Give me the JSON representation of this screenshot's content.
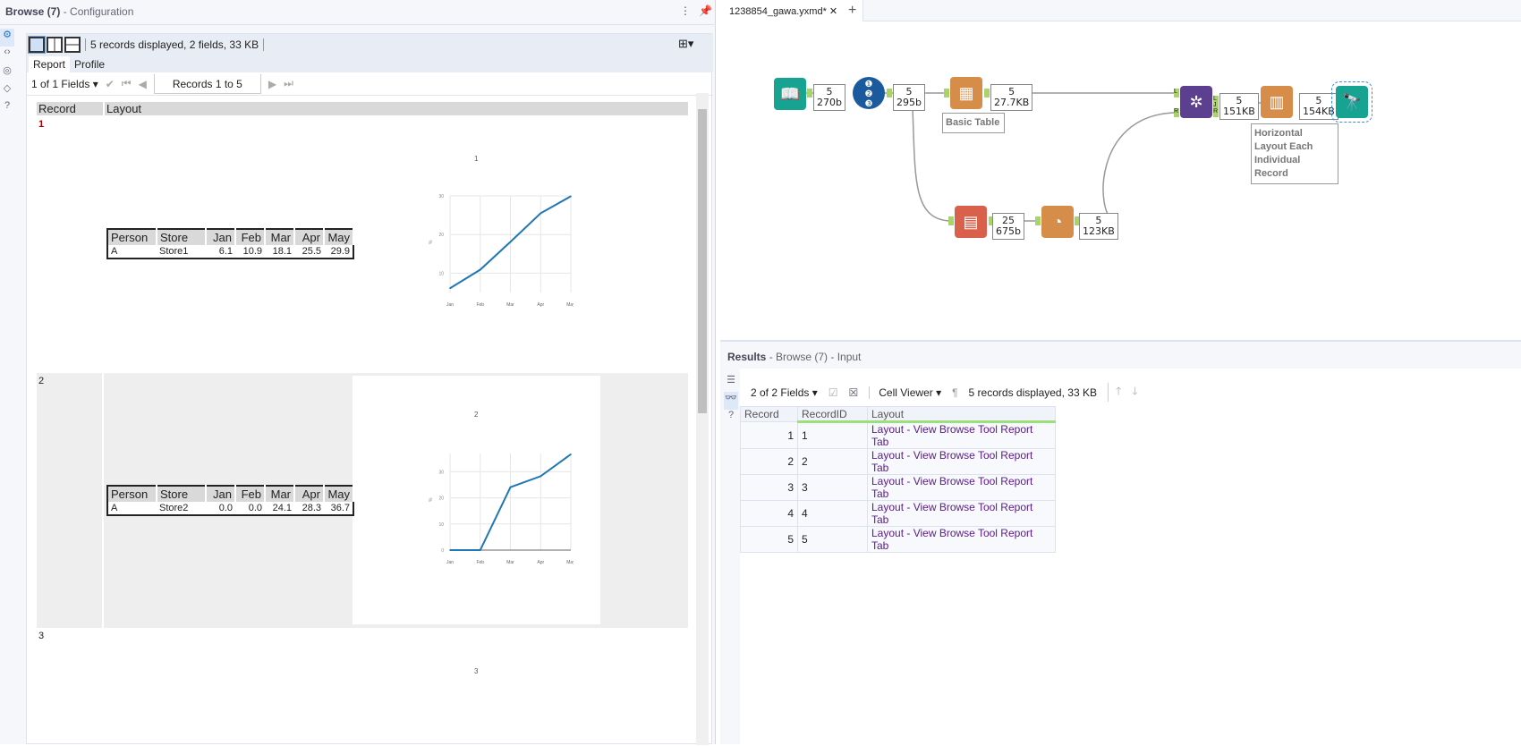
{
  "left_panel": {
    "title": "Browse (7)",
    "subtitle": " - Configuration",
    "status": "5 records displayed, 2 fields, 33 KB",
    "tabs": [
      "Report",
      "Profile"
    ],
    "fields_select": "1 of 1 Fields",
    "records_range": "Records 1 to 5",
    "headers": [
      "Record",
      "Layout"
    ]
  },
  "records": [
    {
      "num": "1",
      "chart_title": "1",
      "table": {
        "headers": [
          "Person",
          "Store",
          "Jan",
          "Feb",
          "Mar",
          "Apr",
          "May"
        ],
        "row": [
          "A",
          "Store1",
          "6.1",
          "10.9",
          "18.1",
          "25.5",
          "29.9"
        ]
      }
    },
    {
      "num": "2",
      "chart_title": "2",
      "table": {
        "headers": [
          "Person",
          "Store",
          "Jan",
          "Feb",
          "Mar",
          "Apr",
          "May"
        ],
        "row": [
          "A",
          "Store2",
          "0.0",
          "0.0",
          "24.1",
          "28.3",
          "36.7"
        ]
      }
    },
    {
      "num": "3",
      "chart_title": "3"
    }
  ],
  "chart_data": [
    {
      "type": "line",
      "title": "1",
      "xlabel": "",
      "ylabel": "%",
      "categories": [
        "Jan",
        "Feb",
        "Mar",
        "Apr",
        "May"
      ],
      "values": [
        6.1,
        10.9,
        18.1,
        25.5,
        29.9
      ],
      "yticks": [
        "10",
        "20",
        "30"
      ],
      "ylim": [
        5,
        30
      ],
      "color": "#1f77b4",
      "grid": true
    },
    {
      "type": "line",
      "title": "2",
      "xlabel": "",
      "ylabel": "%",
      "categories": [
        "Jan",
        "Feb",
        "Mar",
        "Apr",
        "May"
      ],
      "values": [
        0,
        0,
        24.1,
        28.3,
        36.7
      ],
      "yticks": [
        "0",
        "10",
        "20",
        "30"
      ],
      "ylim": [
        0,
        37
      ],
      "color": "#1f77b4",
      "grid": true
    }
  ],
  "workflow": {
    "tab": "1238854_gawa.yxmd*",
    "new_tab": "+",
    "counts": [
      [
        "5",
        "270b"
      ],
      [
        "5",
        "295b"
      ],
      [
        "5",
        "27.7KB"
      ],
      [
        "25",
        "675b"
      ],
      [
        "5",
        "123KB"
      ],
      [
        "5",
        "151KB"
      ],
      [
        "5",
        "154KB"
      ]
    ],
    "labels": {
      "basic_table": "Basic Table",
      "layout": "Horizontal Layout Each Individual Record"
    },
    "join_anchors": [
      "L",
      "R",
      "L",
      "J",
      "R"
    ]
  },
  "results": {
    "title": "Results",
    "subtitle": " - Browse (7) - Input",
    "fields_select": "2 of 2 Fields",
    "viewer": "Cell Viewer",
    "status": "5 records displayed, 33 KB",
    "headers": [
      "Record",
      "RecordID",
      "Layout"
    ],
    "rows": [
      [
        "1",
        "1",
        "Layout - View Browse Tool Report Tab"
      ],
      [
        "2",
        "2",
        "Layout - View Browse Tool Report Tab"
      ],
      [
        "3",
        "3",
        "Layout - View Browse Tool Report Tab"
      ],
      [
        "4",
        "4",
        "Layout - View Browse Tool Report Tab"
      ],
      [
        "5",
        "5",
        "Layout - View Browse Tool Report Tab"
      ]
    ]
  }
}
